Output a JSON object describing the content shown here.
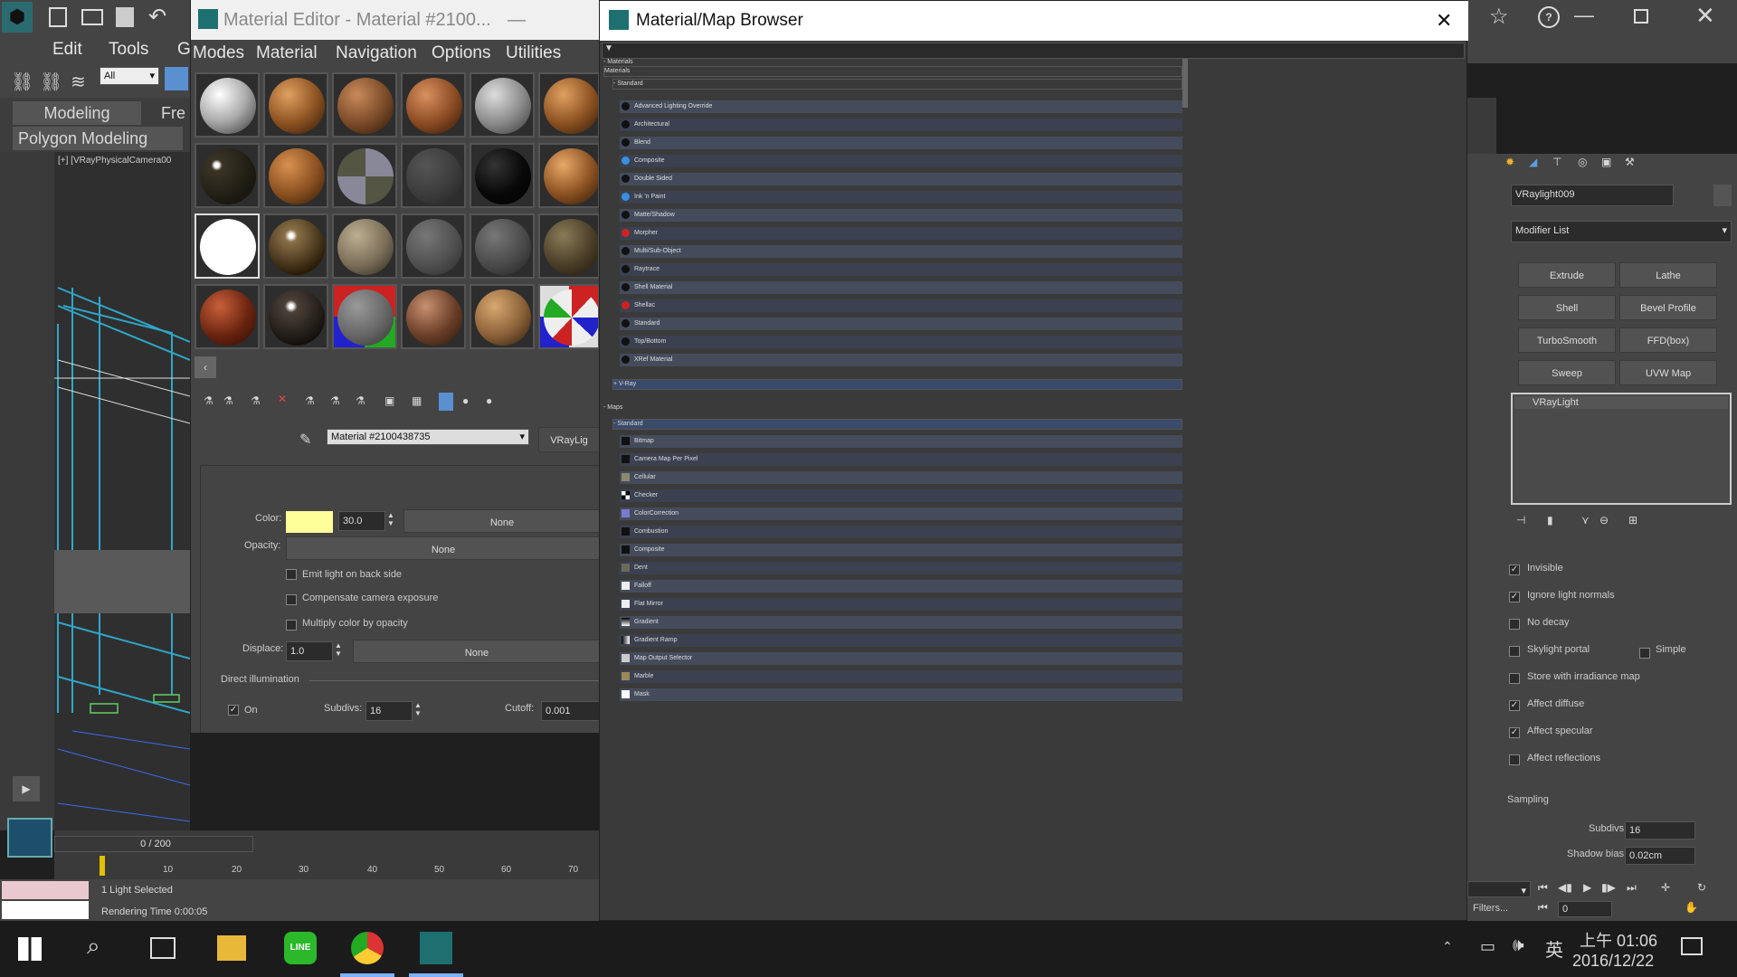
{
  "app": {
    "menu": [
      "Edit",
      "Tools",
      "G"
    ],
    "selection_filter": "All",
    "ribbon_tabs": [
      "Modeling",
      "Fre"
    ],
    "ribbon_panel": "Polygon Modeling",
    "viewport_label": "[+] [VRayPhysicalCamera00",
    "timeline_counter": "0 / 200",
    "timeline_ticks": [
      "0",
      "10",
      "20",
      "30",
      "40",
      "50",
      "60",
      "70"
    ],
    "status_selected": "1 Light Selected",
    "status_render": "Rendering Time 0:00:05"
  },
  "material_editor": {
    "title": "Material Editor - Material #2100...",
    "menu": [
      "Modes",
      "Material",
      "Navigation",
      "Options",
      "Utilities"
    ],
    "material_name": "Material #2100438735",
    "type_button": "VRayLig",
    "color_label": "Color:",
    "color_hex": "#ffff99",
    "color_value": "30.0",
    "color_map": "None",
    "opacity_label": "Opacity:",
    "opacity_map": "None",
    "emit_back_label": "Emit light on back side",
    "compensate_label": "Compensate camera exposure",
    "multiply_label": "Multiply color by opacity",
    "displace_label": "Displace:",
    "displace_value": "1.0",
    "displace_map": "None",
    "direct_illum_label": "Direct illumination",
    "on_label": "On",
    "subdivs_label": "Subdivs:",
    "subdivs_value": "16",
    "cutoff_label": "Cutoff:",
    "cutoff_value": "0.001"
  },
  "browser": {
    "title": "Material/Map Browser",
    "materials_header": "- Materials",
    "materials_sub": "Materials",
    "standard_header": "- Standard",
    "materials": [
      "Advanced Lighting Override",
      "Architectural",
      "Blend",
      "Composite",
      "Double Sided",
      "Ink 'n Paint",
      "Matte/Shadow",
      "Morpher",
      "Multi/Sub-Object",
      "Raytrace",
      "Shell Material",
      "Shellac",
      "Standard",
      "Top/Bottom",
      "XRef Material"
    ],
    "vray_header": "+ V-Ray",
    "maps_header": "- Maps",
    "maps_standard_header": "- Standard",
    "maps": [
      "Bitmap",
      "Camera Map Per Pixel",
      "Cellular",
      "Checker",
      "ColorCorrection",
      "Combustion",
      "Composite",
      "Dent",
      "Falloff",
      "Flat Mirror",
      "Gradient",
      "Gradient Ramp",
      "Map Output Selector",
      "Marble",
      "Mask"
    ]
  },
  "right_panel": {
    "object_name": "VRaylight009",
    "modifier_list": "Modifier List",
    "buttons": [
      "Extrude",
      "Lathe",
      "Shell",
      "Bevel Profile",
      "TurboSmooth",
      "FFD(box)",
      "Sweep",
      "UVW Map"
    ],
    "stack_item": "VRayLight",
    "options": [
      {
        "label": "Invisible",
        "checked": true
      },
      {
        "label": "Ignore light normals",
        "checked": true
      },
      {
        "label": "No decay",
        "checked": false
      },
      {
        "label": "Skylight portal",
        "checked": false
      },
      {
        "label": "Store with irradiance map",
        "checked": false
      },
      {
        "label": "Affect diffuse",
        "checked": true
      },
      {
        "label": "Affect specular",
        "checked": true
      },
      {
        "label": "Affect reflections",
        "checked": false
      }
    ],
    "simple_label": "Simple",
    "sampling_label": "Sampling",
    "subdivs_label": "Subdivs:",
    "subdivs_value": "16",
    "shadow_bias_label": "Shadow bias:",
    "shadow_bias_value": "0.02cm",
    "filters_label": "Filters...",
    "frame_value": "0"
  },
  "taskbar": {
    "ime": "英",
    "time": "上午 01:06",
    "date": "2016/12/22"
  }
}
